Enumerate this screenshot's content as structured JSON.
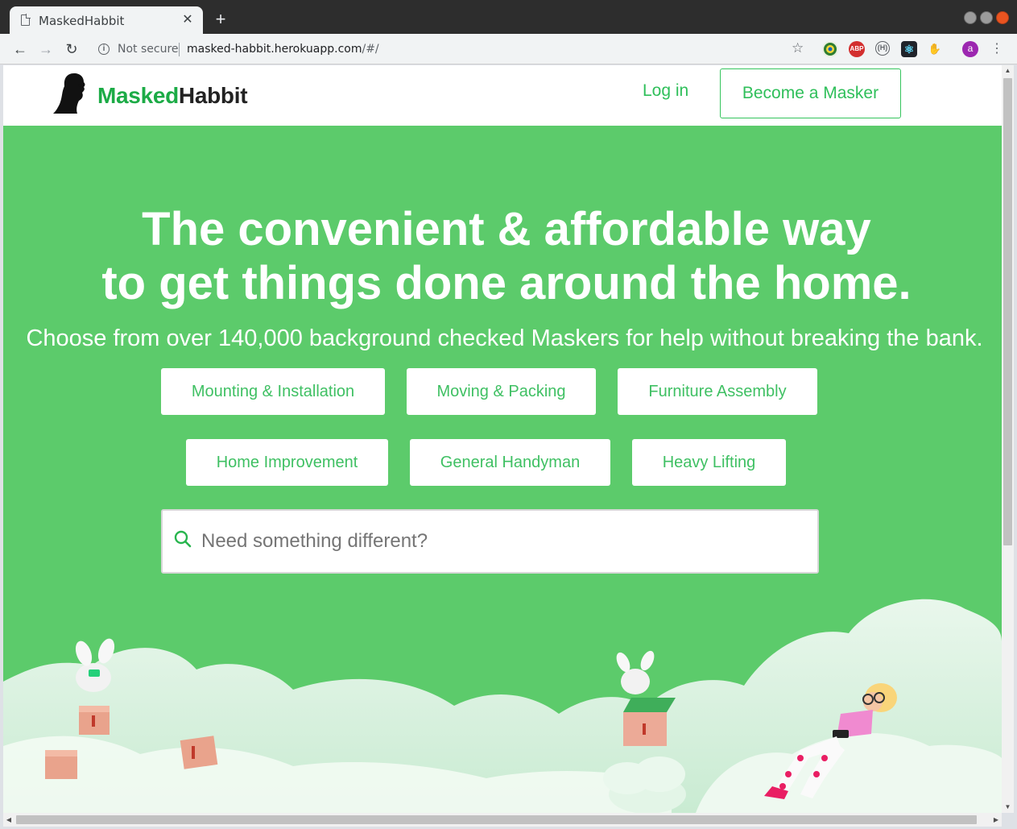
{
  "browser": {
    "tab_title": "MaskedHabbit",
    "tab_close": "✕",
    "new_tab": "+",
    "security_label": "Not secure",
    "url_host": "masked-habbit.herokuapp.com",
    "url_path": "/#/",
    "profile_initial": "a",
    "extensions": [
      {
        "name": "globe-extension-icon",
        "label": ""
      },
      {
        "name": "adblock-icon",
        "label": "ABP"
      },
      {
        "name": "hypothesis-icon",
        "label": "(H)"
      },
      {
        "name": "react-devtools-icon",
        "label": "⚛"
      },
      {
        "name": "hand-extension-icon",
        "label": "✋"
      }
    ]
  },
  "header": {
    "logo_masked": "Masked",
    "logo_habbit": "Habbit",
    "login_label": "Log in",
    "become_label": "Become a Masker"
  },
  "hero": {
    "headline_line1": "The convenient & affordable way",
    "headline_line2": "to get things done around the home.",
    "subline": "Choose from over 140,000 background checked Maskers for help without breaking the bank.",
    "categories": [
      "Mounting & Installation",
      "Moving & Packing",
      "Furniture Assembly",
      "Home Improvement",
      "General Handyman",
      "Heavy Lifting"
    ],
    "search_placeholder": "Need something different?"
  },
  "colors": {
    "brand_green": "#5ccb6b",
    "accent_green": "#2fbf5a",
    "logo_green": "#1cab46"
  }
}
